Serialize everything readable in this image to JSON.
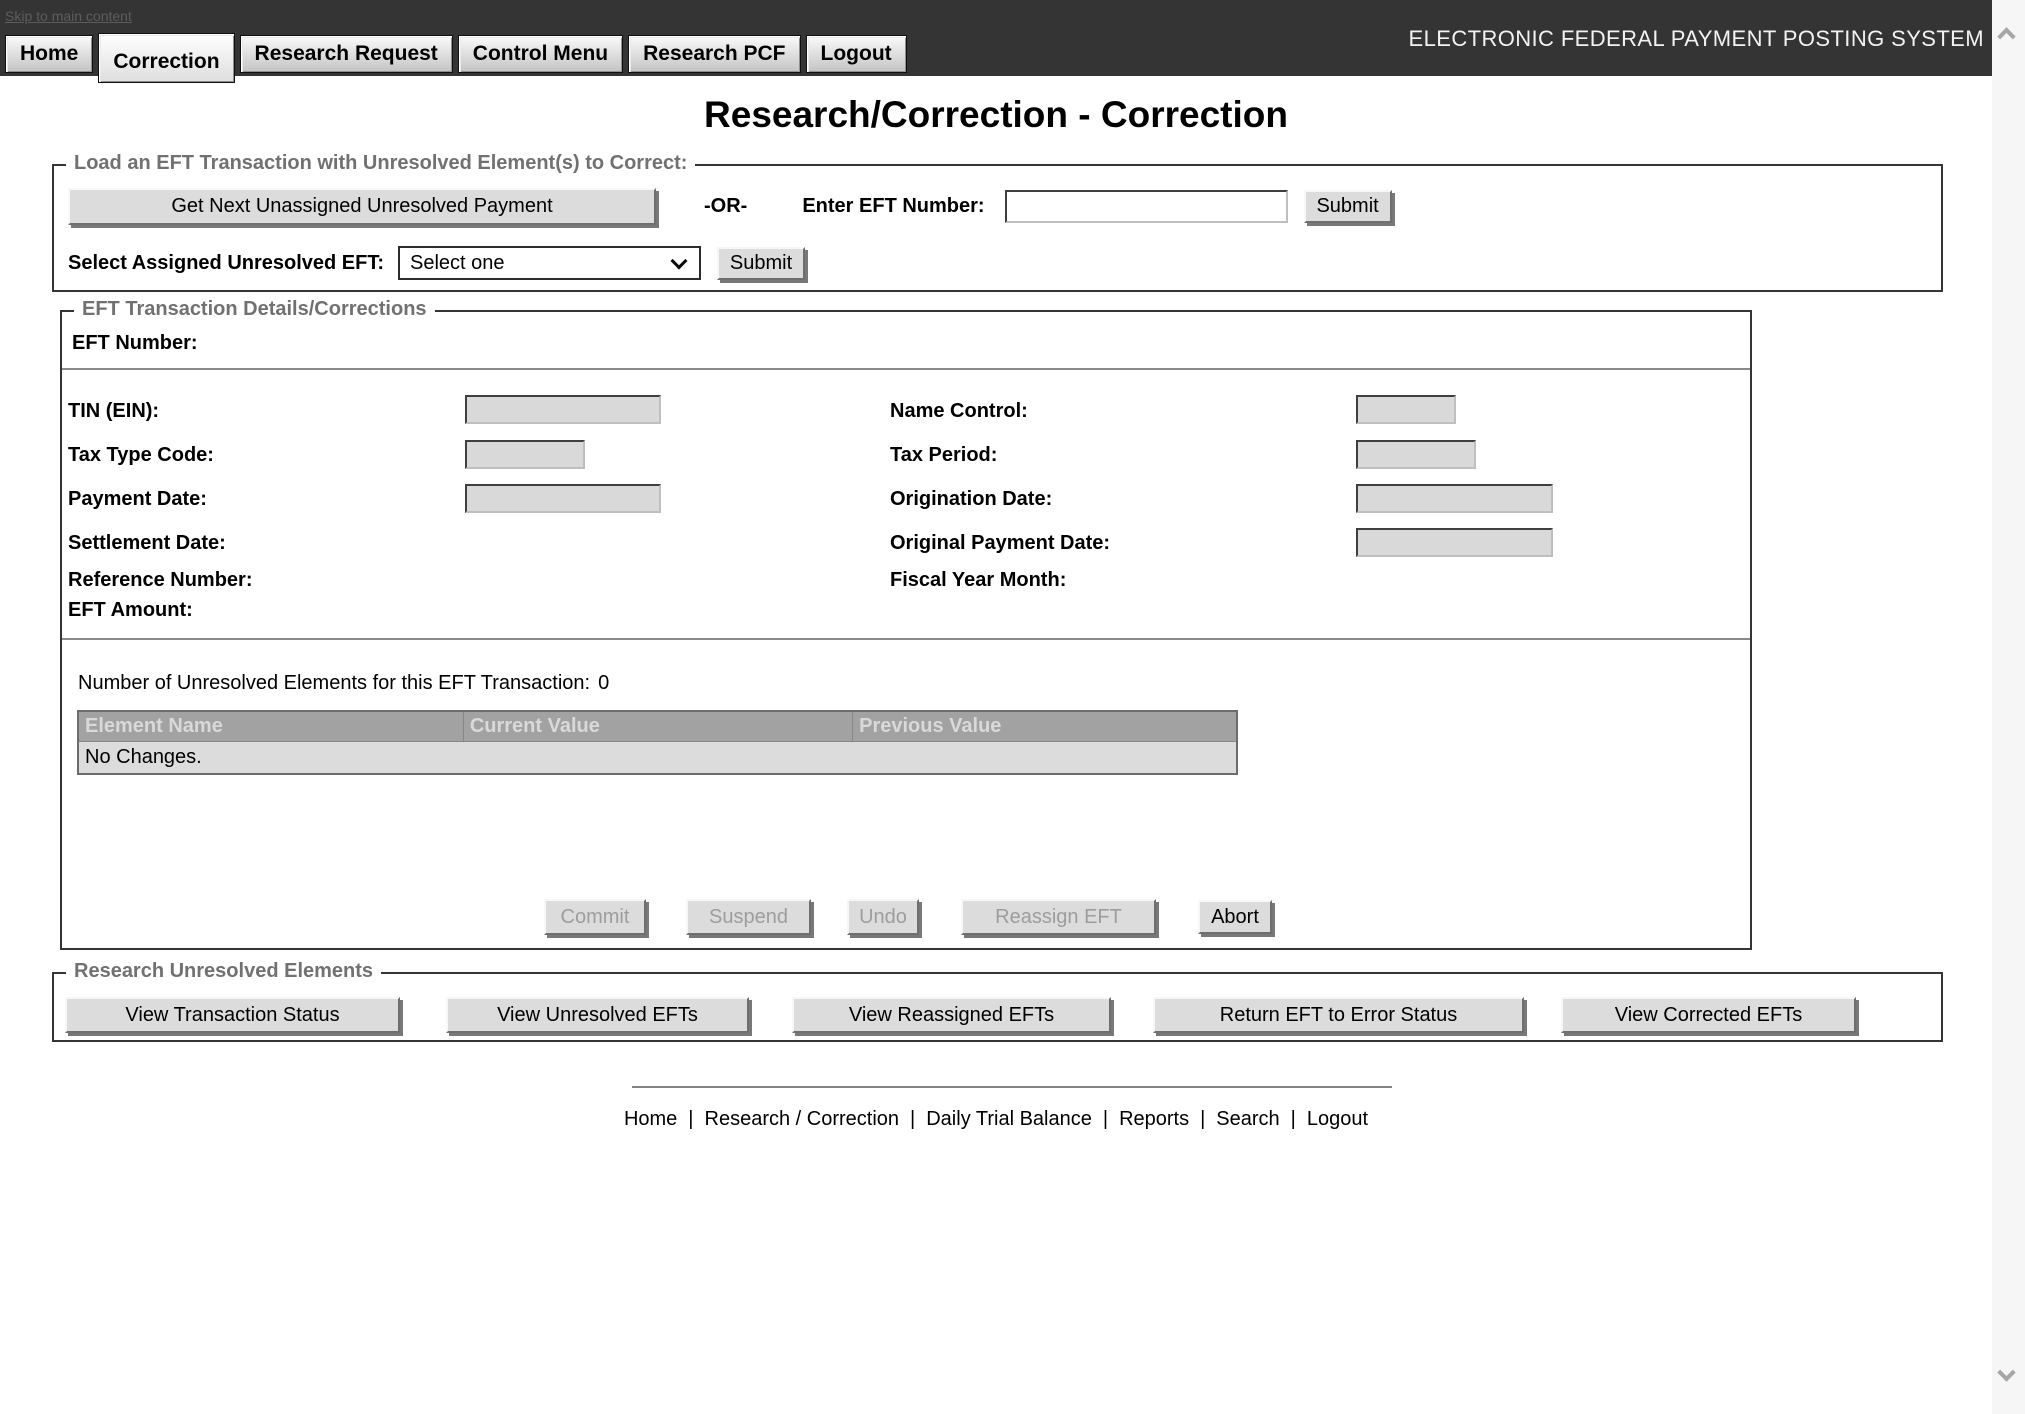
{
  "header": {
    "skip_link": "Skip to main content",
    "system_title": "ELECTRONIC FEDERAL PAYMENT POSTING SYSTEM",
    "active_tab": "Correction",
    "tabs": [
      {
        "label": "Home"
      },
      {
        "label": "Correction"
      },
      {
        "label": "Research Request"
      },
      {
        "label": "Control Menu"
      },
      {
        "label": "Research PCF"
      },
      {
        "label": "Logout"
      }
    ]
  },
  "page_title": "Research/Correction - Correction",
  "load_section": {
    "legend": "Load an EFT Transaction with Unresolved Element(s) to Correct:",
    "get_next_button": "Get Next Unassigned Unresolved Payment",
    "or_text": "-OR-",
    "enter_eft_label": "Enter EFT Number:",
    "eft_number_value": "",
    "eft_submit_button": "Submit",
    "select_label": "Select Assigned Unresolved EFT:",
    "select_selected_option": "Select one",
    "select_submit_button": "Submit"
  },
  "details_section": {
    "legend": "EFT Transaction Details/Corrections",
    "eft_number_label": "EFT Number:",
    "fields": {
      "tin": {
        "label": "TIN (EIN):",
        "value": ""
      },
      "name_control": {
        "label": "Name Control:",
        "value": ""
      },
      "tax_type_code": {
        "label": "Tax Type Code:",
        "value": ""
      },
      "tax_period": {
        "label": "Tax Period:",
        "value": ""
      },
      "payment_date": {
        "label": "Payment Date:",
        "value": ""
      },
      "origination_date": {
        "label": "Origination Date:",
        "value": ""
      },
      "settlement_date": {
        "label": "Settlement Date:"
      },
      "original_payment_date": {
        "label": "Original Payment Date:",
        "value": ""
      },
      "reference_number": {
        "label": "Reference Number:"
      },
      "fiscal_year_month": {
        "label": "Fiscal Year Month:"
      },
      "eft_amount": {
        "label": "EFT Amount:"
      }
    },
    "unresolved_count_text": "Number of Unresolved Elements for this EFT Transaction:",
    "unresolved_count": "0",
    "table": {
      "headers": [
        "Element Name",
        "Current Value",
        "Previous Value"
      ],
      "empty_row_text": "No Changes."
    },
    "action_buttons": [
      {
        "label": "Commit",
        "enabled": false
      },
      {
        "label": "Suspend",
        "enabled": false
      },
      {
        "label": "Undo",
        "enabled": false
      },
      {
        "label": "Reassign EFT",
        "enabled": false
      },
      {
        "label": "Abort",
        "enabled": true
      }
    ]
  },
  "research_section": {
    "legend": "Research Unresolved Elements",
    "buttons": [
      {
        "label": "View Transaction Status"
      },
      {
        "label": "View Unresolved EFTs"
      },
      {
        "label": "View Reassigned EFTs"
      },
      {
        "label": "Return EFT to Error Status"
      },
      {
        "label": "View Corrected EFTs"
      }
    ]
  },
  "footer": {
    "separator": "|",
    "links": [
      {
        "label": "Home"
      },
      {
        "label": "Research / Correction"
      },
      {
        "label": "Daily Trial Balance"
      },
      {
        "label": "Reports"
      },
      {
        "label": "Search"
      },
      {
        "label": "Logout"
      }
    ]
  },
  "colors": {
    "topbar_bg": "#343434",
    "button_face": "#dcdcdc",
    "disabled_input_bg": "#d9d9d9",
    "table_header_bg": "#a2a2a2",
    "table_header_text": "#d9d9d9",
    "table_row_bg": "#dcdcdc",
    "legend_text": "#717171"
  }
}
